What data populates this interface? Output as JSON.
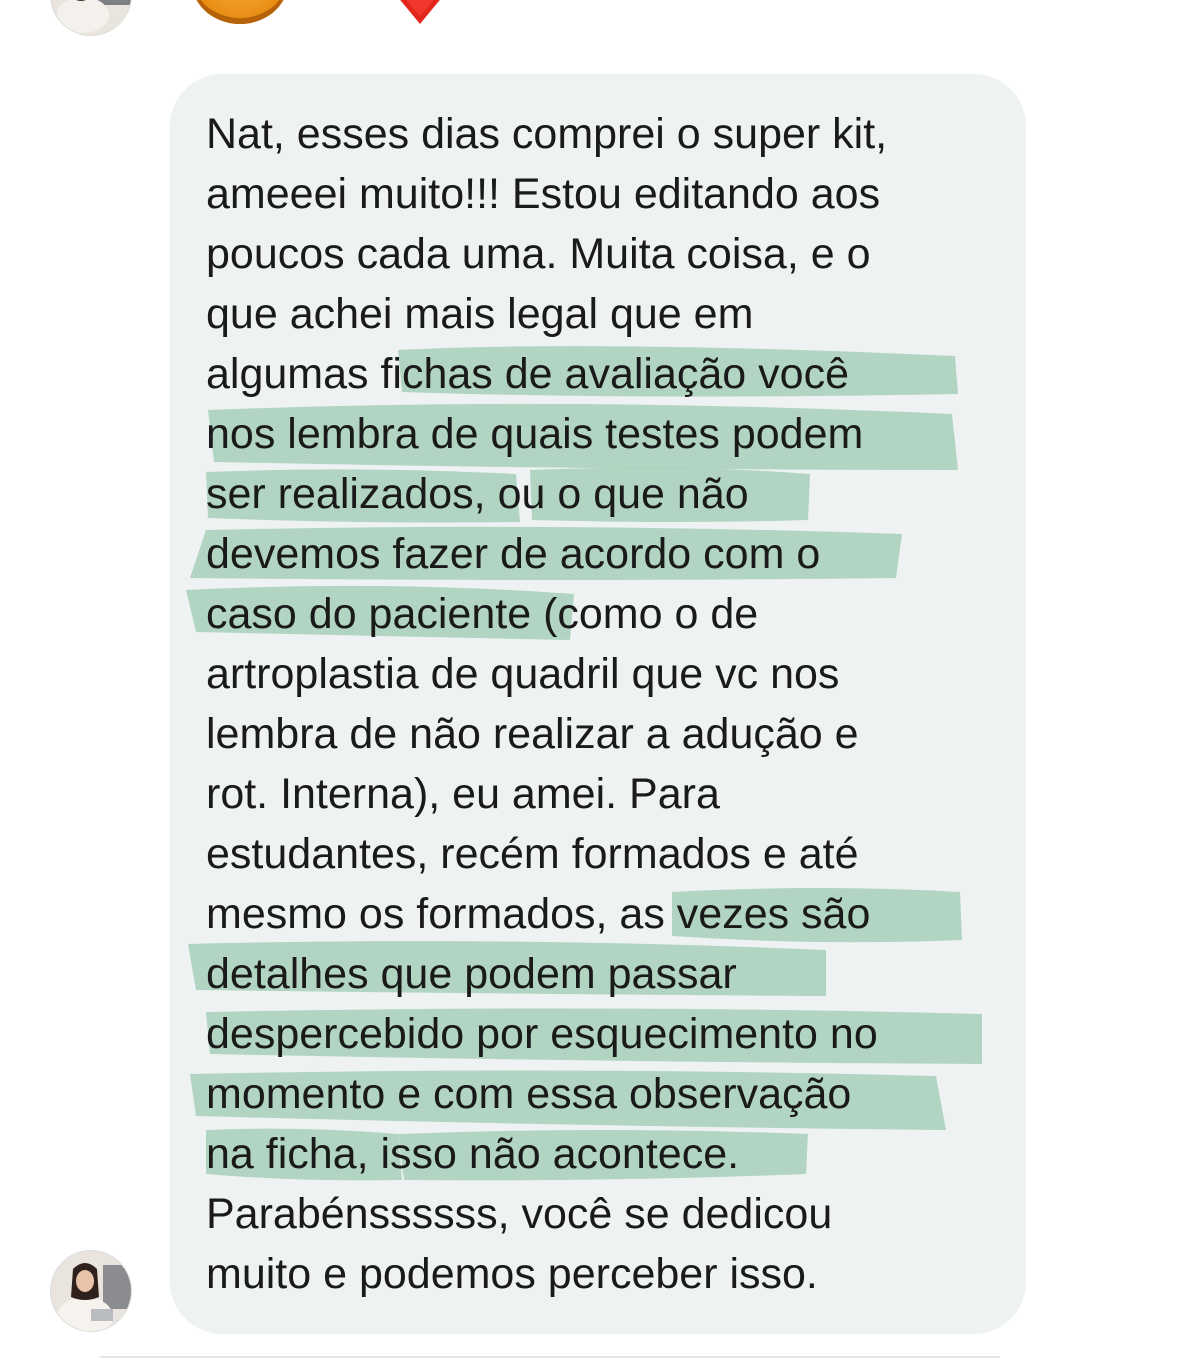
{
  "message": {
    "lines": [
      "Nat, esses dias comprei o super kit,",
      "ameeei muito!!! Estou editando aos",
      "poucos cada uma. Muita coisa, e o",
      "que achei mais legal que em",
      "algumas fichas de avaliação você",
      "nos lembra de quais testes podem",
      "ser realizados, ou o que não",
      "devemos fazer de acordo com o",
      "caso do paciente (como o de",
      "artroplastia de quadril que vc nos",
      "lembra de não realizar a adução e",
      "rot. Interna), eu amei. Para",
      "estudantes, recém formados e até",
      "mesmo os formados, as vezes são",
      "detalhes que podem passar",
      "despercebido por esquecimento no",
      "momento e com essa observação",
      "na ficha, isso não acontece.",
      "Parabénssssss, você se dedicou",
      "muito e podemos perceber isso."
    ]
  },
  "colors": {
    "bubble": "#eff2f3",
    "highlight": "#a9d3bd",
    "text": "#1a1a1a"
  },
  "reactions": [
    "smiley-emoji",
    "heart-emoji"
  ]
}
